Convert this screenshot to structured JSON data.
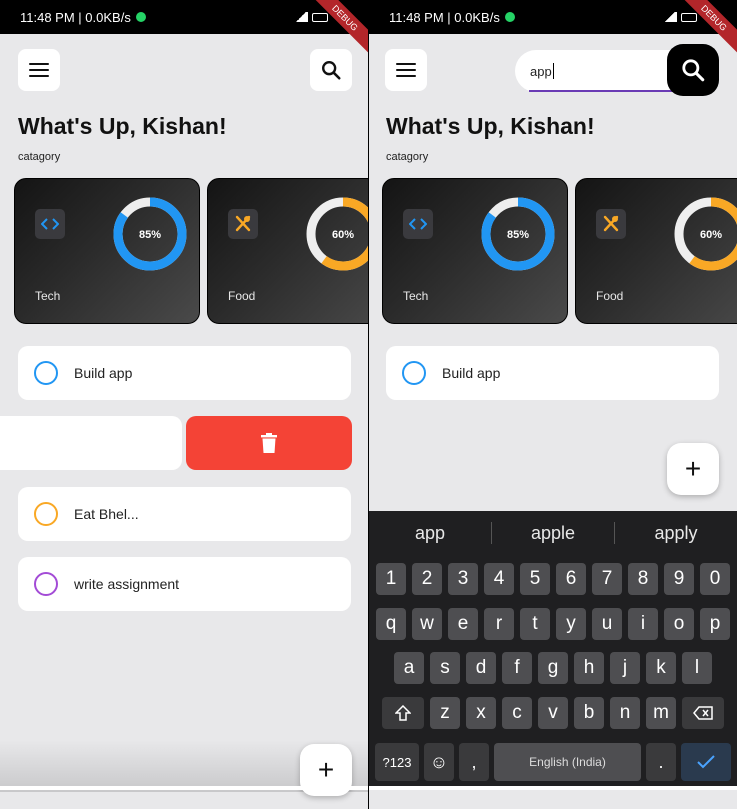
{
  "status": {
    "time": "11:48 PM",
    "speed": "0.0KB/s",
    "debug_label": "DEBUG"
  },
  "header": {
    "greeting": "What's Up, Kishan!",
    "category_label": "catagory"
  },
  "categories": [
    {
      "name": "Tech",
      "percent": 85,
      "percent_label": "85%",
      "color": "#2196f3",
      "icon": "code-icon"
    },
    {
      "name": "Food",
      "percent": 60,
      "percent_label": "60%",
      "color": "#f9a825",
      "icon": "utensils-icon"
    }
  ],
  "tasks": [
    {
      "label": "Build app",
      "color": "#2196f3"
    },
    {
      "label": "",
      "color": "#f44336",
      "state": "swiped-to-delete"
    },
    {
      "label": "Eat Bhel...",
      "color": "#f9a825"
    },
    {
      "label": "write assignment",
      "color": "#a34bd6"
    }
  ],
  "fab_label": "+",
  "search": {
    "value": "app"
  },
  "filtered_tasks": [
    {
      "label": "Build app",
      "color": "#2196f3"
    }
  ],
  "keyboard": {
    "suggestions": [
      "app",
      "apple",
      "apply"
    ],
    "row_numbers": [
      "1",
      "2",
      "3",
      "4",
      "5",
      "6",
      "7",
      "8",
      "9",
      "0"
    ],
    "row1": [
      "q",
      "w",
      "e",
      "r",
      "t",
      "y",
      "u",
      "i",
      "o",
      "p"
    ],
    "row2": [
      "a",
      "s",
      "d",
      "f",
      "g",
      "h",
      "j",
      "k",
      "l"
    ],
    "row3": [
      "z",
      "x",
      "c",
      "v",
      "b",
      "n",
      "m"
    ],
    "symbols_label": "?123",
    "comma_label": ",",
    "space_label": "English (India)",
    "period_label": "."
  },
  "colors": {
    "accent": "#6a3bb5",
    "delete": "#f44336",
    "tech": "#2196f3",
    "food": "#f9a825"
  }
}
